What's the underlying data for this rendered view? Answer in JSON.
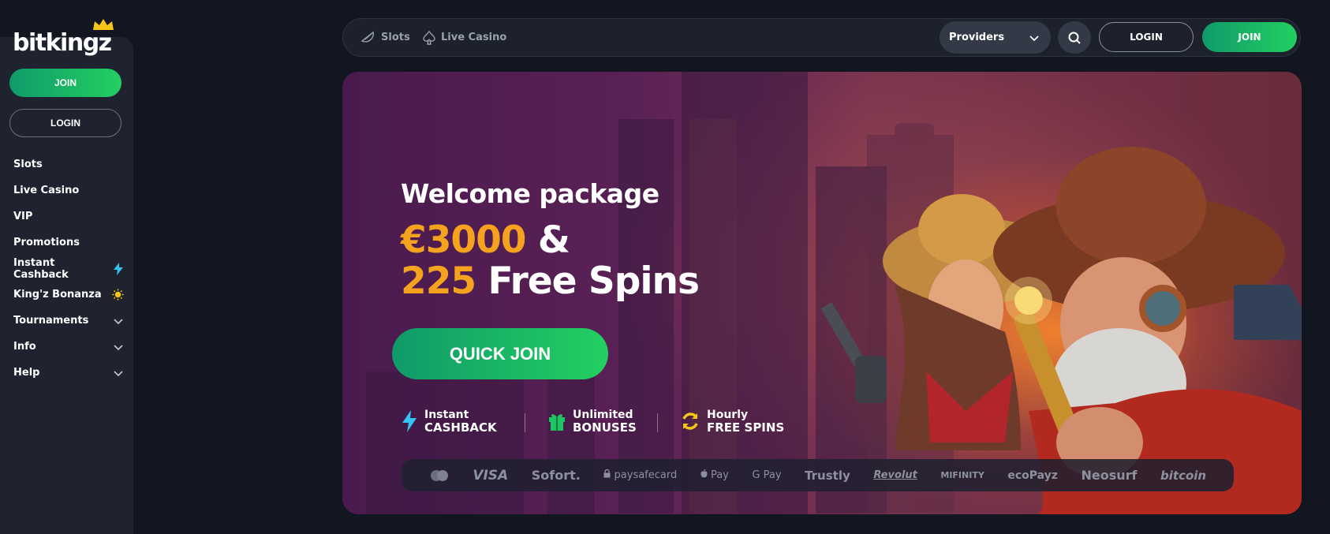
{
  "brand": {
    "logo_text": "bitkingz",
    "accent": "#1fc463",
    "gold": "#f5a21f"
  },
  "sidebar": {
    "join_label": "JOIN",
    "login_label": "LOGIN",
    "items": [
      {
        "label": "Slots",
        "icon": ""
      },
      {
        "label": "Live Casino",
        "icon": ""
      },
      {
        "label": "VIP",
        "icon": ""
      },
      {
        "label": "Promotions",
        "icon": ""
      },
      {
        "label": "Instant Cashback",
        "icon": "lightning-icon"
      },
      {
        "label": "King'z Bonanza",
        "icon": "sun-icon"
      },
      {
        "label": "Tournaments",
        "icon": "chevron-down-icon"
      },
      {
        "label": "Info",
        "icon": "chevron-down-icon"
      },
      {
        "label": "Help",
        "icon": "chevron-down-icon"
      }
    ]
  },
  "topbar": {
    "slots_label": "Slots",
    "live_casino_label": "Live Casino",
    "providers_label": "Providers",
    "login_label": "LOGIN",
    "join_label": "JOIN"
  },
  "hero": {
    "title": "Welcome package",
    "line1_amount": "€3000",
    "line1_rest": "&",
    "line2_amount": "225",
    "line2_rest": "Free Spins",
    "cta_label": "QUICK JOIN",
    "perks": [
      {
        "top": "Instant",
        "bottom": "CASHBACK",
        "icon": "lightning-icon"
      },
      {
        "top": "Unlimited",
        "bottom": "BONUSES",
        "icon": "gift-icon"
      },
      {
        "top": "Hourly",
        "bottom": "FREE SPINS",
        "icon": "refresh-icon"
      }
    ],
    "payments": [
      "VISA",
      "Sofort.",
      "paysafecard",
      "Pay",
      "G Pay",
      "Trustly",
      "Revolut",
      "MIFINITY",
      "ecoPayz",
      "Neosurf",
      "bitcoin"
    ]
  }
}
